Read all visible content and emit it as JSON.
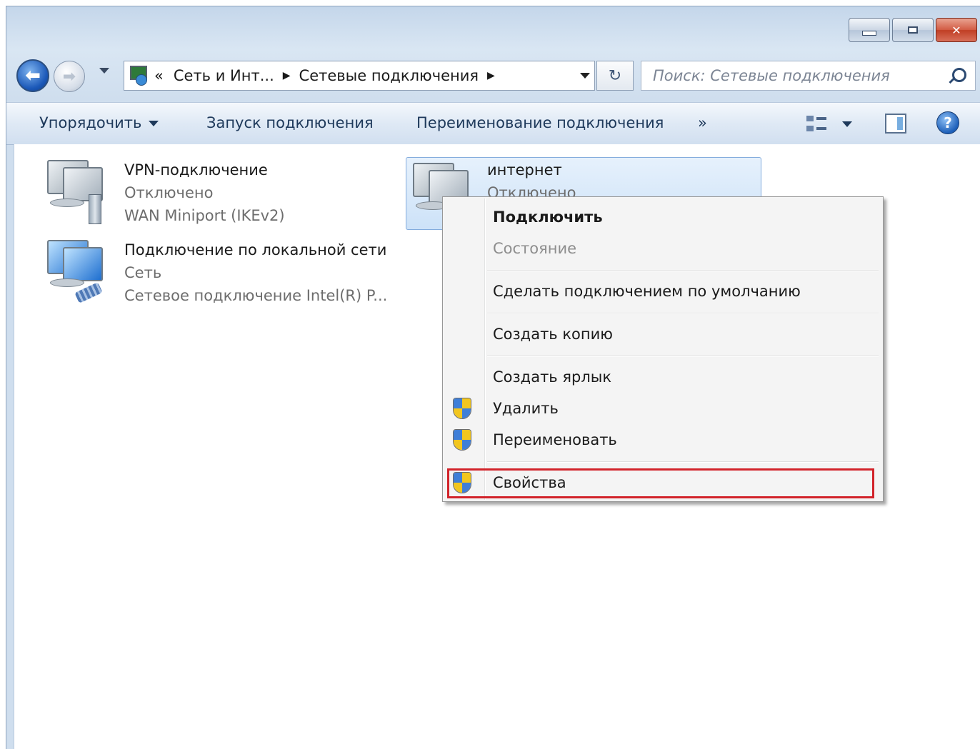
{
  "window": {
    "caption_close_glyph": "✕"
  },
  "nav": {
    "back_glyph": "⬅",
    "forward_glyph": "➡",
    "breadcrumb_prefix": "«",
    "breadcrumb": [
      "Сеть и Инт...",
      "Сетевые подключения"
    ],
    "breadcrumb_sep": "▶",
    "refresh_glyph": "↻",
    "search_placeholder": "Поиск: Сетевые подключения"
  },
  "toolbar": {
    "organize": "Упорядочить",
    "start_connection": "Запуск подключения",
    "rename_connection": "Переименование подключения",
    "more": "»",
    "help_glyph": "?"
  },
  "connections": [
    {
      "name": "VPN-подключение",
      "status": "Отключено",
      "device": "WAN Miniport (IKEv2)"
    },
    {
      "name": "Подключение по локальной сети",
      "status": "Сеть",
      "device": "Сетевое подключение Intel(R) P..."
    },
    {
      "name": "интернет",
      "status": "Отключено",
      "selected": true
    }
  ],
  "context_menu": {
    "items": [
      {
        "label": "Подключить",
        "bold": true
      },
      {
        "label": "Состояние",
        "disabled": true
      },
      {
        "label": "Сделать подключением по умолчанию"
      },
      {
        "label": "Создать копию"
      },
      {
        "label": "Создать ярлык"
      },
      {
        "label": "Удалить",
        "icon": "uac-shield-icon"
      },
      {
        "label": "Переименовать",
        "icon": "uac-shield-icon"
      },
      {
        "label": "Свойства",
        "icon": "uac-shield-icon",
        "highlighted": true
      }
    ],
    "highlight_color": "#d2232a"
  },
  "colors": {
    "selection_bg": "#cde2f8",
    "toolbar_text": "#1e395b"
  }
}
